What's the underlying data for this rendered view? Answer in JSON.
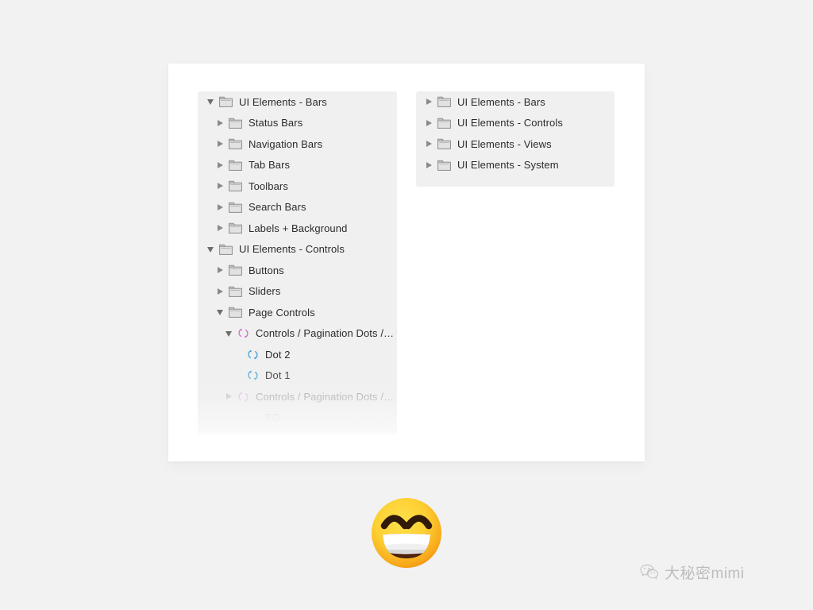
{
  "page": {
    "background_color": "#f2f2f2",
    "card_background": "#ffffff",
    "panel_background": "#f0f0f0"
  },
  "left_panel": {
    "name": "layer-list-panel",
    "rows": [
      {
        "label": "UI Elements - Bars",
        "icon": "folder-icon",
        "disclosure": "down",
        "indent": 0,
        "dim": 0,
        "icon_color": "#8c8c8c"
      },
      {
        "label": "Status Bars",
        "icon": "folder-icon",
        "disclosure": "right",
        "indent": 1,
        "dim": 0,
        "icon_color": "#8c8c8c"
      },
      {
        "label": "Navigation Bars",
        "icon": "folder-icon",
        "disclosure": "right",
        "indent": 1,
        "dim": 0,
        "icon_color": "#8c8c8c"
      },
      {
        "label": "Tab Bars",
        "icon": "folder-icon",
        "disclosure": "right",
        "indent": 1,
        "dim": 0,
        "icon_color": "#8c8c8c"
      },
      {
        "label": "Toolbars",
        "icon": "folder-icon",
        "disclosure": "right",
        "indent": 1,
        "dim": 0,
        "icon_color": "#8c8c8c"
      },
      {
        "label": "Search Bars",
        "icon": "folder-icon",
        "disclosure": "right",
        "indent": 1,
        "dim": 0,
        "icon_color": "#8c8c8c"
      },
      {
        "label": "Labels + Background",
        "icon": "folder-icon",
        "disclosure": "right",
        "indent": 1,
        "dim": 0,
        "icon_color": "#8c8c8c"
      },
      {
        "label": "UI Elements - Controls",
        "icon": "folder-icon",
        "disclosure": "down",
        "indent": 0,
        "dim": 0,
        "icon_color": "#8c8c8c"
      },
      {
        "label": "Buttons",
        "icon": "folder-icon",
        "disclosure": "right",
        "indent": 1,
        "dim": 0,
        "icon_color": "#8c8c8c"
      },
      {
        "label": "Sliders",
        "icon": "folder-icon",
        "disclosure": "right",
        "indent": 1,
        "dim": 0,
        "icon_color": "#8c8c8c"
      },
      {
        "label": "Page Controls",
        "icon": "folder-icon",
        "disclosure": "down",
        "indent": 1,
        "dim": 0,
        "icon_color": "#8c8c8c"
      },
      {
        "label": "Controls / Pagination Dots /…",
        "icon": "symbol-icon",
        "disclosure": "down",
        "indent": 2,
        "dim": 0,
        "icon_color": "#cd6cc8"
      },
      {
        "label": "Dot 2",
        "icon": "symbol-icon",
        "disclosure": "none",
        "indent": 3,
        "dim": 0,
        "icon_color": "#3fa0d8"
      },
      {
        "label": "Dot 1",
        "icon": "symbol-icon",
        "disclosure": "none",
        "indent": 3,
        "dim": 0,
        "icon_color": "#3fa0d8"
      },
      {
        "label": "Controls / Pagination Dots /…",
        "icon": "symbol-icon",
        "disclosure": "right",
        "indent": 2,
        "dim": 1,
        "icon_color": "#cd6cc8"
      },
      {
        "label": "BG",
        "icon": "line-icon",
        "disclosure": "none",
        "indent": 3,
        "dim": 2,
        "icon_color": "#c9c9c9"
      }
    ]
  },
  "right_panel": {
    "name": "symbols-list-panel",
    "rows": [
      {
        "label": "UI Elements - Bars",
        "icon": "folder-icon",
        "disclosure": "right",
        "indent": 0,
        "dim": 0,
        "icon_color": "#8c8c8c"
      },
      {
        "label": "UI Elements - Controls",
        "icon": "folder-icon",
        "disclosure": "right",
        "indent": 0,
        "dim": 0,
        "icon_color": "#8c8c8c"
      },
      {
        "label": "UI Elements - Views",
        "icon": "folder-icon",
        "disclosure": "right",
        "indent": 0,
        "dim": 0,
        "icon_color": "#8c8c8c"
      },
      {
        "label": "UI Elements - System",
        "icon": "folder-icon",
        "disclosure": "right",
        "indent": 0,
        "dim": 0,
        "icon_color": "#8c8c8c"
      }
    ]
  },
  "emoji": {
    "name": "grinning-face-with-smiling-eyes-emoji",
    "character": "😄"
  },
  "watermark": {
    "icon": "wechat-icon",
    "text": "大秘密mimi",
    "color": "#bdbdbd"
  }
}
